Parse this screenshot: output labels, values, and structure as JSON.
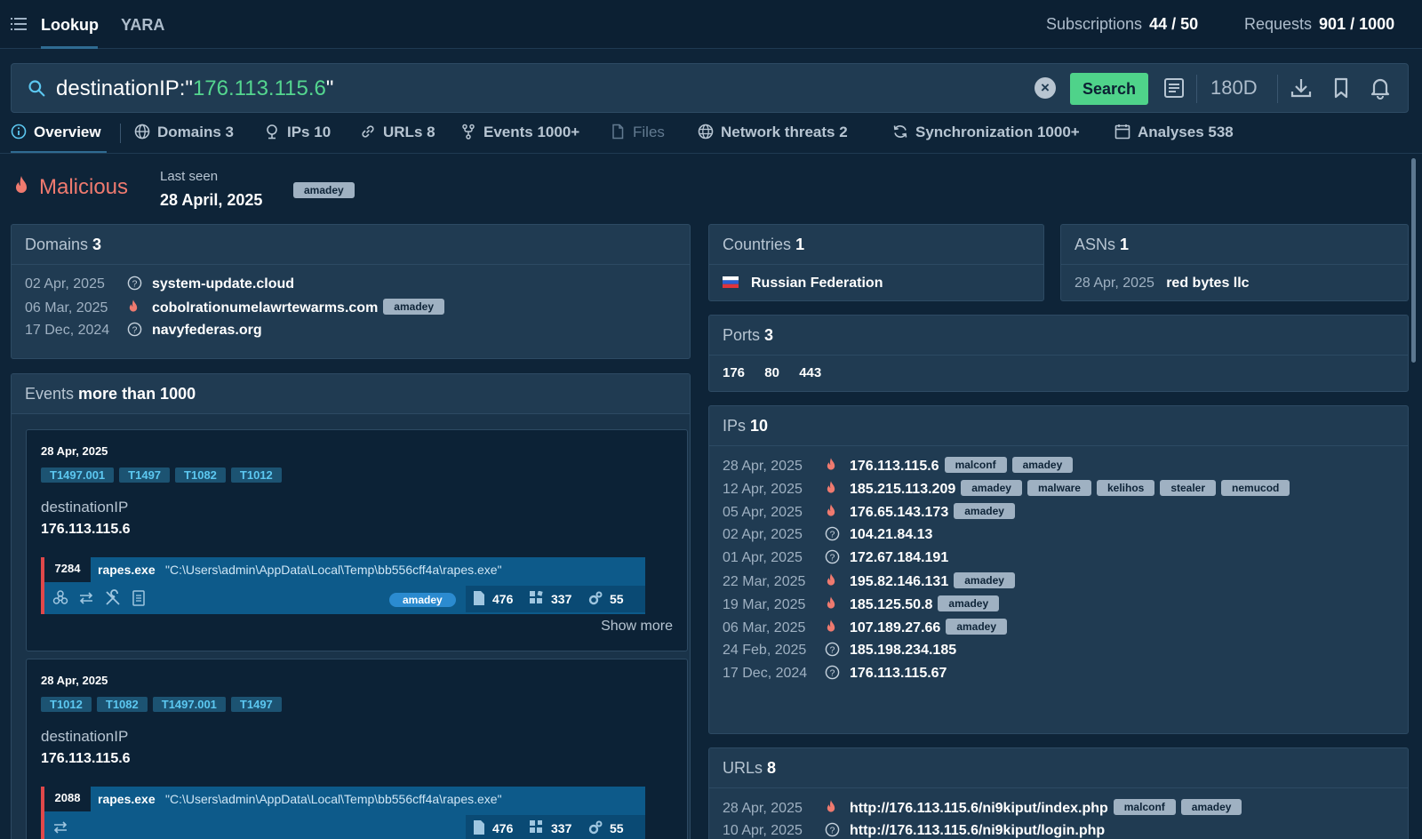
{
  "topbar": {
    "tabs": [
      "Lookup",
      "YARA"
    ],
    "subscriptions_label": "Subscriptions",
    "subscriptions_value": "44 / 50",
    "requests_label": "Requests",
    "requests_value": "901 / 1000"
  },
  "search": {
    "query_prefix": "destinationIP:\"",
    "query_ip": "176.113.115.6",
    "query_suffix": "\"",
    "search_label": "Search",
    "period": "180D"
  },
  "tabs": [
    {
      "label": "Overview",
      "icon": "info-icon"
    },
    {
      "label": "Domains 3",
      "icon": "globe-icon"
    },
    {
      "label": "IPs 10",
      "icon": "location-pin-icon"
    },
    {
      "label": "URLs 8",
      "icon": "link-icon"
    },
    {
      "label": "Events 1000+",
      "icon": "fork-icon"
    },
    {
      "label": "Files",
      "icon": "file-icon"
    },
    {
      "label": "Network threats 2",
      "icon": "network-globe-icon"
    },
    {
      "label": "Synchronization 1000+",
      "icon": "sync-icon"
    },
    {
      "label": "Analyses 538",
      "icon": "calendar-icon"
    }
  ],
  "verdict": {
    "label": "Malicious",
    "last_seen_label": "Last seen",
    "last_seen_date": "28 April, 2025",
    "tag": "amadey"
  },
  "domains": {
    "title": "Domains",
    "count": "3",
    "items": [
      {
        "date": "02 Apr, 2025",
        "status": "unknown",
        "name": "system-update.cloud",
        "tags": []
      },
      {
        "date": "06 Mar, 2025",
        "status": "malicious",
        "name": "cobolrationumelawrtewarms.com",
        "tags": [
          "amadey"
        ]
      },
      {
        "date": "17 Dec, 2024",
        "status": "unknown",
        "name": "navyfederas.org",
        "tags": []
      }
    ]
  },
  "countries": {
    "title": "Countries",
    "count": "1",
    "items": [
      {
        "name": "Russian Federation"
      }
    ]
  },
  "asns": {
    "title": "ASNs",
    "count": "1",
    "items": [
      {
        "date": "28 Apr, 2025",
        "name": "red bytes llc"
      }
    ]
  },
  "ports": {
    "title": "Ports",
    "count": "3",
    "items": [
      "176",
      "80",
      "443"
    ]
  },
  "ips": {
    "title": "IPs",
    "count": "10",
    "items": [
      {
        "date": "28 Apr, 2025",
        "status": "malicious",
        "name": "176.113.115.6",
        "tags": [
          "malconf",
          "amadey"
        ]
      },
      {
        "date": "12 Apr, 2025",
        "status": "malicious",
        "name": "185.215.113.209",
        "tags": [
          "amadey",
          "malware",
          "kelihos",
          "stealer",
          "nemucod"
        ]
      },
      {
        "date": "05 Apr, 2025",
        "status": "malicious",
        "name": "176.65.143.173",
        "tags": [
          "amadey"
        ]
      },
      {
        "date": "02 Apr, 2025",
        "status": "unknown",
        "name": "104.21.84.13",
        "tags": []
      },
      {
        "date": "01 Apr, 2025",
        "status": "unknown",
        "name": "172.67.184.191",
        "tags": []
      },
      {
        "date": "22 Mar, 2025",
        "status": "malicious",
        "name": "195.82.146.131",
        "tags": [
          "amadey"
        ]
      },
      {
        "date": "19 Mar, 2025",
        "status": "malicious",
        "name": "185.125.50.8",
        "tags": [
          "amadey"
        ]
      },
      {
        "date": "06 Mar, 2025",
        "status": "malicious",
        "name": "107.189.27.66",
        "tags": [
          "amadey"
        ]
      },
      {
        "date": "24 Feb, 2025",
        "status": "unknown",
        "name": "185.198.234.185",
        "tags": []
      },
      {
        "date": "17 Dec, 2024",
        "status": "unknown",
        "name": "176.113.115.67",
        "tags": []
      }
    ]
  },
  "urls": {
    "title": "URLs",
    "count": "8",
    "items": [
      {
        "date": "28 Apr, 2025",
        "status": "malicious",
        "name": "http://176.113.115.6/ni9kiput/index.php",
        "tags": [
          "malconf",
          "amadey"
        ]
      },
      {
        "date": "10 Apr, 2025",
        "status": "unknown",
        "name": "http://176.113.115.6/ni9kiput/login.php",
        "tags": []
      }
    ]
  },
  "events": {
    "title": "Events",
    "count": "more than 1000",
    "items": [
      {
        "date": "28 Apr, 2025",
        "mitre": [
          "T1497.001",
          "T1497",
          "T1082",
          "T1012"
        ],
        "field_label": "destinationIP",
        "field_value": "176.113.115.6",
        "pid": "7284",
        "exe": "rapes.exe",
        "cmd": "\"C:\\Users\\admin\\AppData\\Local\\Temp\\bb556cff4a\\rapes.exe\"",
        "tag": "amadey",
        "files": "476",
        "registry": "337",
        "modules": "55",
        "show_more": "Show more"
      },
      {
        "date": "28 Apr, 2025",
        "mitre": [
          "T1012",
          "T1082",
          "T1497.001",
          "T1497"
        ],
        "field_label": "destinationIP",
        "field_value": "176.113.115.6",
        "pid": "2088",
        "exe": "rapes.exe",
        "cmd": "\"C:\\Users\\admin\\AppData\\Local\\Temp\\bb556cff4a\\rapes.exe\"",
        "files": "476",
        "registry": "337",
        "modules": "55"
      }
    ]
  },
  "colors": {
    "background": "#0e2438",
    "panel": "#203b52",
    "accent_green": "#4fd38a",
    "malicious": "#ef7a6f",
    "mitre_text": "#5cc7f0"
  }
}
